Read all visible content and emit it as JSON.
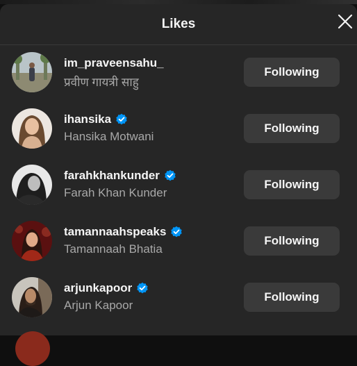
{
  "modal": {
    "title": "Likes",
    "close_icon": "close-icon"
  },
  "users": [
    {
      "username": "im_praveensahu_",
      "full_name": "प्रवीण गायत्री साहु",
      "verified": false,
      "button_label": "Following"
    },
    {
      "username": "ihansika",
      "full_name": "Hansika Motwani",
      "verified": true,
      "button_label": "Following"
    },
    {
      "username": "farahkhankunder",
      "full_name": "Farah Khan Kunder",
      "verified": true,
      "button_label": "Following"
    },
    {
      "username": "tamannaahspeaks",
      "full_name": "Tamannaah Bhatia",
      "verified": true,
      "button_label": "Following"
    },
    {
      "username": "arjunkapoor",
      "full_name": "Arjun Kapoor",
      "verified": true,
      "button_label": "Following"
    }
  ],
  "colors": {
    "modal_bg": "#262626",
    "button_bg": "#3a3a3a",
    "verified_blue": "#0095f6",
    "secondary_text": "#a8a8a8"
  }
}
